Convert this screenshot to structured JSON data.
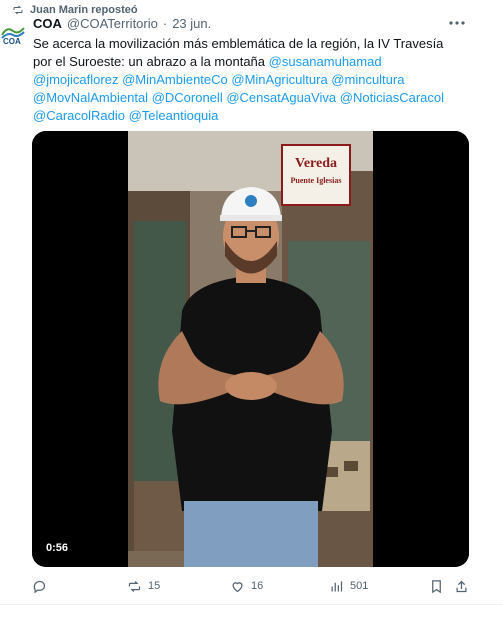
{
  "repost": {
    "label": "Juan Marin reposteó",
    "icon": "repost-icon"
  },
  "tweet": {
    "author": {
      "name": "COA",
      "handle": "@COATerritorio",
      "separator": "·",
      "date": "23 jun.",
      "avatar_text": "COA"
    },
    "text": {
      "line1": "Se acerca la movilización más emblemática de la región, la IV Travesía por",
      "line2_plain": "el Suroeste: un abrazo a la montaña",
      "mentions": [
        "@susanamuhamad",
        "@jmojicaflorez",
        "@MinAmbienteCo",
        "@MinAgricultura",
        "@mincultura",
        "@MovNalAmbiental",
        "@DCoronell",
        "@CensatAguaViva",
        "@NoticiasCaracol",
        "@CaracolRadio",
        "@Teleantioquia"
      ]
    },
    "media": {
      "duration": "0:56",
      "sign_line1": "Vereda",
      "sign_line2": "Puente Iglesias"
    },
    "stats": {
      "reposts": "15",
      "likes": "16",
      "views": "501"
    }
  },
  "colors": {
    "accent": "#1d9bf0",
    "muted": "#536471"
  }
}
